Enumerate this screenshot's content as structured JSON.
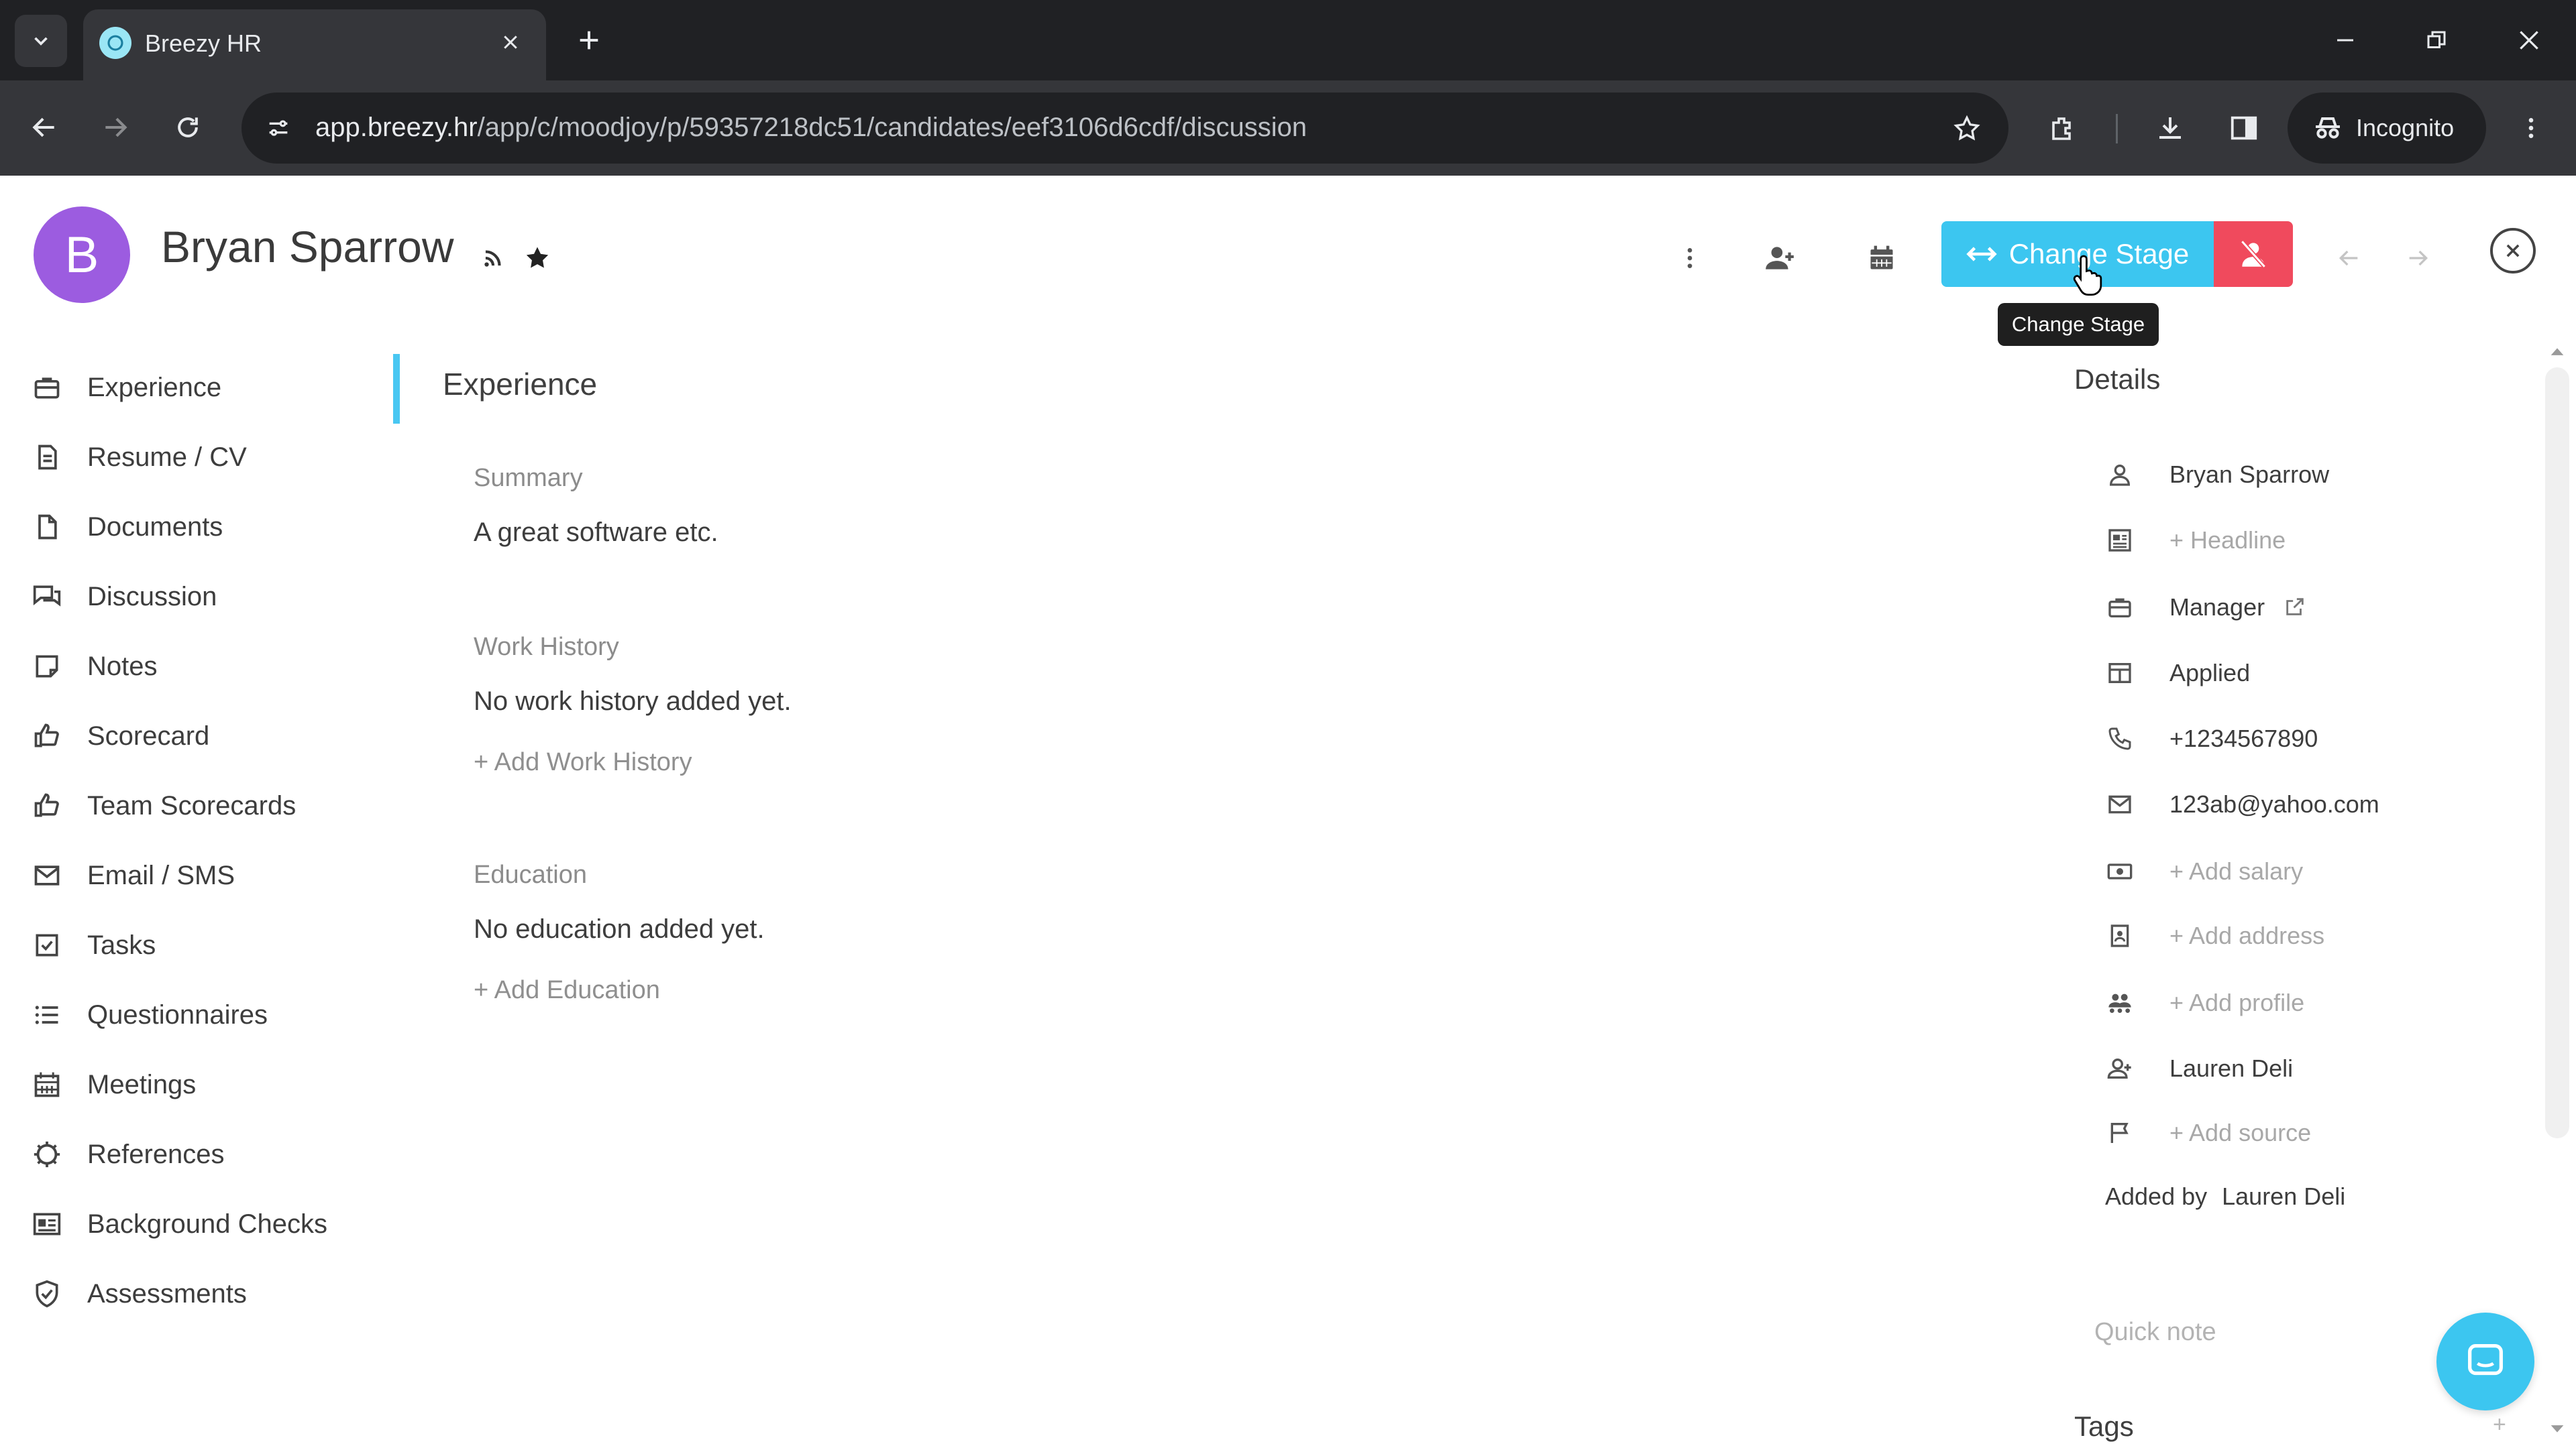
{
  "browser": {
    "tab_title": "Breezy HR",
    "url_host": "app.breezy.hr",
    "url_path": "/app/c/moodjoy/p/59357218dc51/candidates/eef3106d6cdf/discussion",
    "incognito_label": "Incognito"
  },
  "candidate": {
    "avatar_letter": "B",
    "name": "Bryan Sparrow"
  },
  "header": {
    "change_stage_label": "Change Stage",
    "tooltip": "Change Stage"
  },
  "sidebar": {
    "items": [
      {
        "label": "Experience",
        "icon": "briefcase-icon"
      },
      {
        "label": "Resume / CV",
        "icon": "file-text-icon"
      },
      {
        "label": "Documents",
        "icon": "document-icon"
      },
      {
        "label": "Discussion",
        "icon": "chat-icon"
      },
      {
        "label": "Notes",
        "icon": "note-icon"
      },
      {
        "label": "Scorecard",
        "icon": "thumbs-up-icon"
      },
      {
        "label": "Team Scorecards",
        "icon": "thumbs-up-icon"
      },
      {
        "label": "Email / SMS",
        "icon": "mail-icon"
      },
      {
        "label": "Tasks",
        "icon": "checkbox-icon"
      },
      {
        "label": "Questionnaires",
        "icon": "list-icon"
      },
      {
        "label": "Meetings",
        "icon": "calendar-icon"
      },
      {
        "label": "References",
        "icon": "gear-icon"
      },
      {
        "label": "Background Checks",
        "icon": "id-card-icon"
      },
      {
        "label": "Assessments",
        "icon": "shield-icon"
      }
    ]
  },
  "main": {
    "section_title": "Experience",
    "summary_label": "Summary",
    "summary_text": "A great software etc.",
    "work_history_label": "Work History",
    "work_history_empty": "No work history added yet.",
    "add_work_history": "+ Add Work History",
    "education_label": "Education",
    "education_empty": "No education added yet.",
    "add_education": "+ Add Education"
  },
  "details": {
    "title": "Details",
    "rows": [
      {
        "text": "Bryan Sparrow",
        "icon": "person-icon"
      },
      {
        "text": "+ Headline",
        "icon": "newspaper-icon"
      },
      {
        "text": "Manager",
        "icon": "briefcase-icon"
      },
      {
        "text": "Applied",
        "icon": "columns-icon"
      },
      {
        "text": "+1234567890",
        "icon": "phone-icon"
      },
      {
        "text": "123ab@yahoo.com",
        "icon": "mail-icon"
      },
      {
        "text": "+ Add salary",
        "icon": "money-icon"
      },
      {
        "text": "+ Add address",
        "icon": "address-icon"
      },
      {
        "text": "+ Add profile",
        "icon": "people-icon"
      },
      {
        "text": "Lauren Deli",
        "icon": "add-person-icon"
      },
      {
        "text": "+ Add source",
        "icon": "flag-icon"
      }
    ],
    "added_by_label": "Added by",
    "added_by_name": "Lauren Deli",
    "quick_note_placeholder": "Quick note",
    "tags_label": "Tags",
    "tags_add": "+"
  },
  "colors": {
    "accent": "#3cc6f0",
    "danger": "#f04a5d",
    "avatar": "#9c5ce0"
  }
}
